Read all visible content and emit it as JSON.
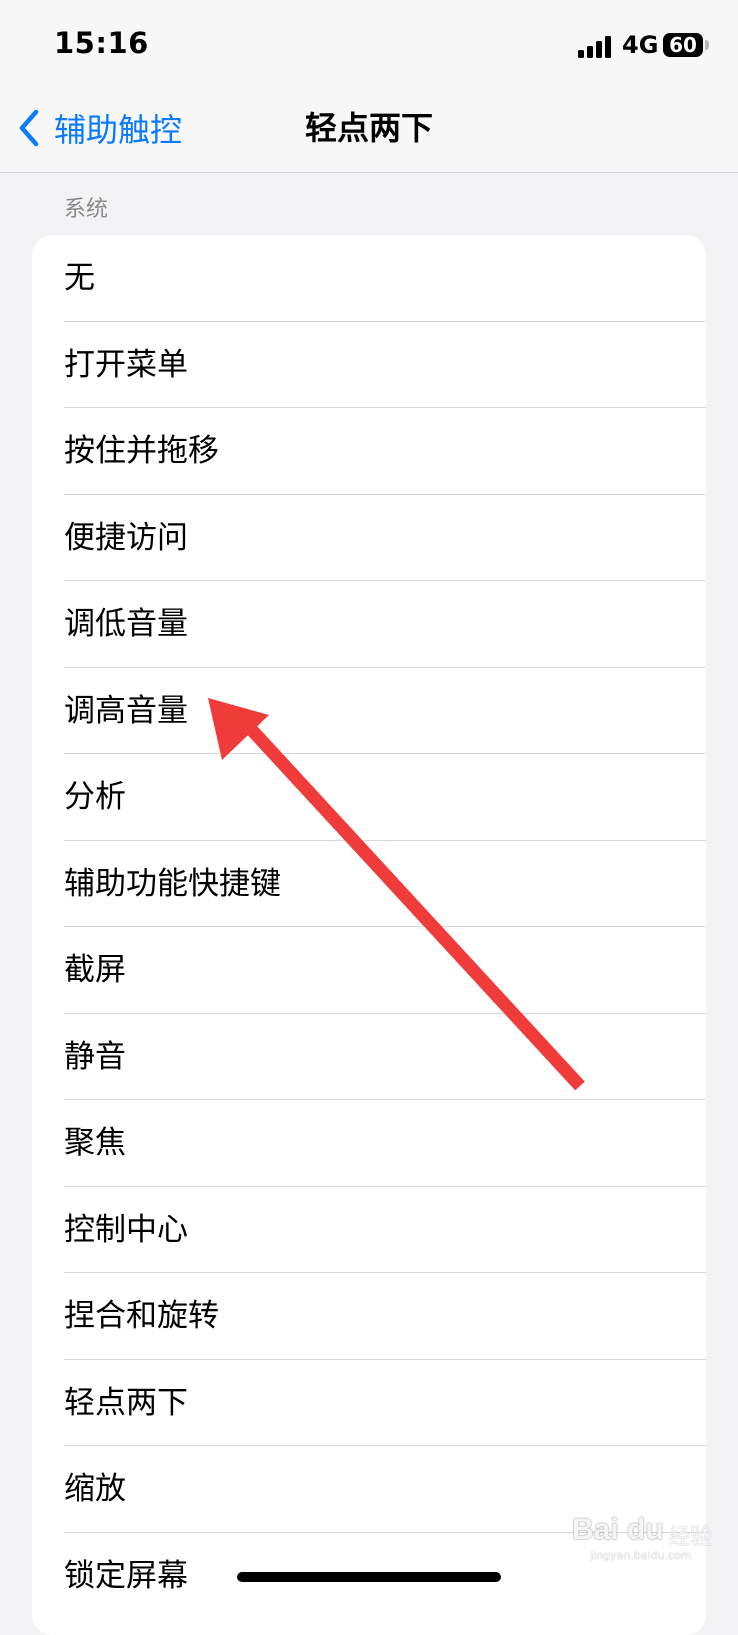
{
  "status_bar": {
    "time": "15:16",
    "network": "4G",
    "battery_level": "60"
  },
  "nav": {
    "back_label": "辅助触控",
    "title": "轻点两下"
  },
  "section": {
    "header": "系统",
    "items": [
      {
        "label": "无"
      },
      {
        "label": "打开菜单"
      },
      {
        "label": "按住并拖移"
      },
      {
        "label": "便捷访问"
      },
      {
        "label": "调低音量"
      },
      {
        "label": "调高音量"
      },
      {
        "label": "分析"
      },
      {
        "label": "辅助功能快捷键"
      },
      {
        "label": "截屏"
      },
      {
        "label": "静音"
      },
      {
        "label": "聚焦"
      },
      {
        "label": "控制中心"
      },
      {
        "label": "捏合和旋转"
      },
      {
        "label": "轻点两下"
      },
      {
        "label": "缩放"
      },
      {
        "label": "锁定屏幕"
      }
    ]
  },
  "watermark": {
    "logo": "Bai du",
    "cn": "经验",
    "url": "jingyan.baidu.com"
  },
  "colors": {
    "accent": "#0a7aff",
    "annotation": "#ef3b3a",
    "background": "#f2f2f7"
  },
  "icons": {
    "back": "chevron-left-icon",
    "signal": "cellular-signal-icon",
    "battery": "battery-icon",
    "annotation": "red-arrow-icon"
  }
}
